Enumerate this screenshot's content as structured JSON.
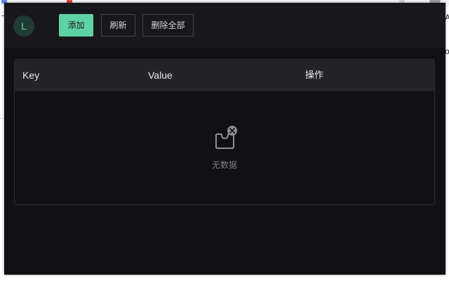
{
  "background_page": {
    "edge_char_top": "A",
    "edge_char_lower": "o"
  },
  "header": {
    "avatar_letter": "L",
    "buttons": {
      "add": "添加",
      "refresh": "刷新",
      "delete_all": "删除全部"
    }
  },
  "table": {
    "columns": [
      "Key",
      "Value",
      "操作"
    ],
    "rows": [],
    "empty_text": "无数据"
  },
  "colors": {
    "accent": "#5fd3a5",
    "popup_bg": "#111015",
    "header_bg": "#18171c",
    "table_head_bg": "#242328"
  },
  "icons": {
    "empty": "empty-inbox-icon"
  }
}
